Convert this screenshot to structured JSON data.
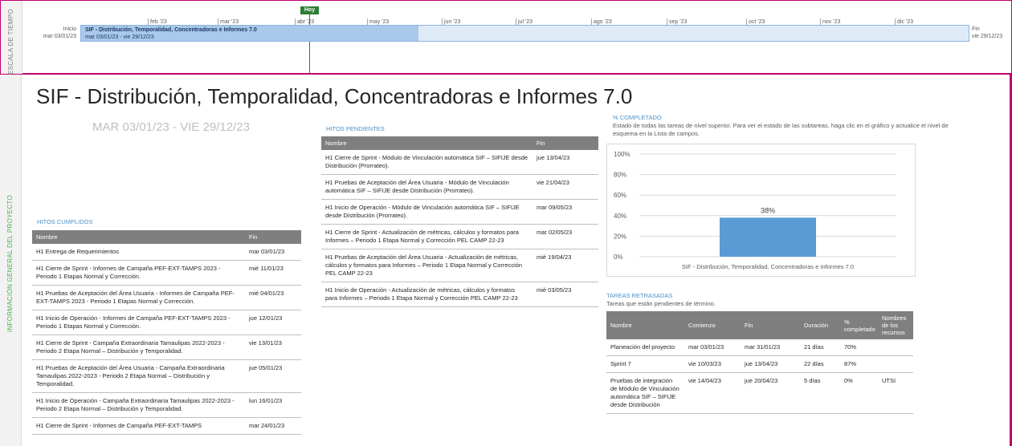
{
  "timescale": {
    "side_label": "ESCALA DE TIEMPO",
    "today_label": "Hoy",
    "ticks": [
      "feb '23",
      "mar '23",
      "abr '23",
      "may '23",
      "jun '23",
      "jul '23",
      "ago '23",
      "sep '23",
      "oct '23",
      "nov '23",
      "dic '23"
    ],
    "start_label": "Inicio",
    "start_date": "mar 03/01/23",
    "end_label": "Fin",
    "end_date": "vie 29/12/23",
    "bar_name": "SIF - Distribución, Temporalidad, Concentradoras  e Informes 7.0",
    "bar_dates": "mar 03/01/23 - vie 29/12/23"
  },
  "report": {
    "side_label": "INFORMACIÓN GENERAL DEL PROYECTO",
    "title": "SIF - Distribución, Temporalidad, Concentradoras  e Informes 7.0",
    "date_range": "MAR 03/01/23 - VIE 29/12/23"
  },
  "hitos_cumplidos": {
    "title": "HITOS CUMPLIDOS",
    "columns": [
      "Nombre",
      "Fin"
    ],
    "rows": [
      {
        "name": "H1 Entrega de Requerimientos",
        "fin": "mar 03/01/23"
      },
      {
        "name": "H1 Cierre de Sprint - Informes de  Campaña PEF-EXT-TAMPS 2023 - Periodo 1 Etapas Normal y Corrección.",
        "fin": "mié 11/01/23"
      },
      {
        "name": "H1 Pruebas de Aceptación del Área Usuaria - Informes de Campaña PEF-EXT-TAMPS 2023 - Periodo 1 Etapas Normal y Corrección.",
        "fin": "mié 04/01/23"
      },
      {
        "name": "H1 Inicio de Operación - Informes de  Campaña PEF-EXT-TAMPS 2023 - Periodo 1 Etapas Normal y Corrección.",
        "fin": "jue 12/01/23"
      },
      {
        "name": "H1 Cierre de Sprint - Campaña Extraordinaria Tamaulipas 2022-2023 - Periodo 2 Etapa Normal – Distribución y Temporalidad.",
        "fin": "vie 13/01/23"
      },
      {
        "name": "H1 Pruebas de Aceptación del Área Usuaria - Campaña Extraordinaria Tamaulipas 2022-2023 - Periodo 2 Etapa Normal – Distribución y Temporalidad.",
        "fin": "jue 05/01/23"
      },
      {
        "name": "H1 Inicio de Operación - Campaña Extraordinaria Tamaulipas 2022-2023 - Periodo 2 Etapa Normal – Distribución y Temporalidad.",
        "fin": "lun 16/01/23"
      },
      {
        "name": "H1 Cierre de Sprint - Informes de  Campaña PEF-EXT-TAMPS",
        "fin": "mar 24/01/23"
      }
    ]
  },
  "hitos_pendientes": {
    "title": "HITOS PENDIENTES",
    "columns": [
      "Nombre",
      "Fin"
    ],
    "rows": [
      {
        "name": "H1 Cierre de Sprint - Módulo de Vinculación automática SIF – SIFIJE desde Distribución (Prorrateo).",
        "fin": "jue 13/04/23"
      },
      {
        "name": "H1 Pruebas de Aceptación del Área Usuaria - Módulo de Vinculación automática SIF – SIFIJE desde Distribución (Prorrateo).",
        "fin": "vie 21/04/23"
      },
      {
        "name": "H1 Inicio de Operación - Módulo de Vinculación automática SIF – SIFIJE desde Distribución (Prorrateo).",
        "fin": "mar 09/05/23"
      },
      {
        "name": "H1 Cierre de Sprint - Actualización de métricas, cálculos y formatos para Informes – Periodo 1 Etapa Normal y Corrección PEL CAMP 22-23",
        "fin": "mar 02/05/23"
      },
      {
        "name": "H1 Pruebas de Aceptación del Área Usuaria - Actualización de métricas, cálculos y formatos para Informes – Periodo 1 Etapa Normal y Corrección PEL CAMP 22-23",
        "fin": "mié 19/04/23"
      },
      {
        "name": "H1 Inicio de Operación - Actualización de métricas, cálculos y formatos para Informes – Periodo 1 Etapa Normal y Corrección PEL CAMP 22-23",
        "fin": "mié 03/05/23"
      }
    ]
  },
  "completado": {
    "title": "% COMPLETADO",
    "description": "Estado de todas las tareas de nivel superior. Para ver el estado de las subtareas, haga clic en el gráfico y actualice el nivel de esquema en la Lista de campos."
  },
  "chart_data": {
    "type": "bar",
    "categories": [
      "SIF - Distribución, Temporalidad, Concentradoras  e Informes 7.0"
    ],
    "values": [
      38
    ],
    "value_labels": [
      "38%"
    ],
    "y_ticks": [
      "0%",
      "20%",
      "40%",
      "60%",
      "80%",
      "100%"
    ],
    "ylim": [
      0,
      100
    ],
    "grid": true,
    "bar_color": "#5b9bd5"
  },
  "tareas_retrasadas": {
    "title": "TAREAS RETRASADAS",
    "description": "Tareas que están pendientes de término.",
    "columns": [
      "Nombre",
      "Comienzo",
      "Fin",
      "Duración",
      "% completado",
      "Nombres de los recursos"
    ],
    "rows": [
      {
        "name": "Planeación del proyecto",
        "start": "mar 03/01/23",
        "fin": "mar 31/01/23",
        "dur": "21 días",
        "pct": "70%",
        "res": ""
      },
      {
        "name": "Sprint 7",
        "start": "vie 10/03/23",
        "fin": "jue 13/04/23",
        "dur": "22 días",
        "pct": "87%",
        "res": ""
      },
      {
        "name": "Pruebas de integración de Módulo de Vinculación automática SIF – SIFIJE desde Distribución",
        "start": "vie 14/04/23",
        "fin": "jue 20/04/23",
        "dur": "5 días",
        "pct": "0%",
        "res": "UTSI"
      }
    ]
  }
}
